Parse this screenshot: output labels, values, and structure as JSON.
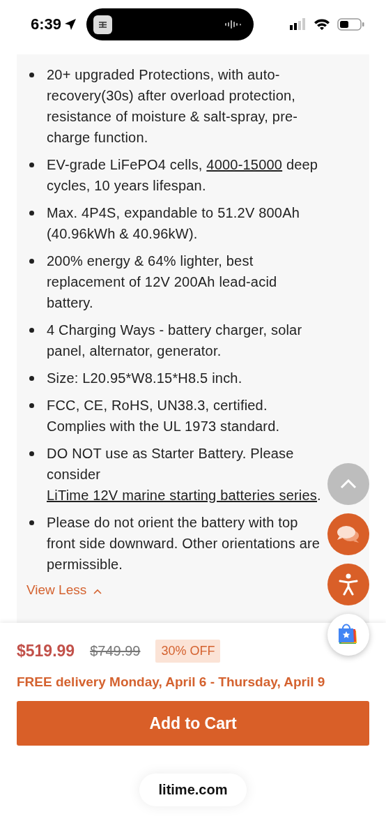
{
  "status_bar": {
    "time": "6:39"
  },
  "features": [
    {
      "parts": [
        {
          "kind": "text",
          "text": "20+ upgraded Protections, with auto-recovery(30s) after overload protection, resistance of moisture & salt-spray, pre-charge function."
        }
      ]
    },
    {
      "parts": [
        {
          "kind": "text",
          "text": "EV-grade LiFePO4 cells, "
        },
        {
          "kind": "link",
          "text": "4000-15000"
        },
        {
          "kind": "text",
          "text": " deep cycles, 10 years lifespan."
        }
      ]
    },
    {
      "parts": [
        {
          "kind": "text",
          "text": "Max. 4P4S, expandable to 51.2V 800Ah (40.96kWh & 40.96kW)."
        }
      ]
    },
    {
      "parts": [
        {
          "kind": "text",
          "text": "200% energy & 64% lighter, best replacement of 12V 200Ah lead-acid battery."
        }
      ]
    },
    {
      "parts": [
        {
          "kind": "text",
          "text": "4 Charging Ways - battery charger, solar panel, alternator, generator."
        }
      ]
    },
    {
      "parts": [
        {
          "kind": "text",
          "text": "Size: L20.95*W8.15*H8.5 inch."
        }
      ]
    },
    {
      "parts": [
        {
          "kind": "text",
          "text": "FCC, CE, RoHS, UN38.3, certified. Complies with the UL 1973 standard."
        }
      ]
    },
    {
      "parts": [
        {
          "kind": "text",
          "text": "DO NOT use as Starter Battery. Please consider "
        },
        {
          "kind": "link",
          "text": "LiTime 12V marine starting batteries series"
        },
        {
          "kind": "text",
          "text": "."
        }
      ]
    },
    {
      "parts": [
        {
          "kind": "text",
          "text": "Please do not orient the battery with top front side downward. Other orientations are permissible."
        }
      ]
    }
  ],
  "view_less": "View Less",
  "price": {
    "current": "$519.99",
    "original": "$749.99",
    "discount": "30% OFF"
  },
  "delivery": "FREE delivery Monday, April 6 - Thursday, April 9",
  "add_to_cart": "Add to Cart",
  "url": "litime.com"
}
